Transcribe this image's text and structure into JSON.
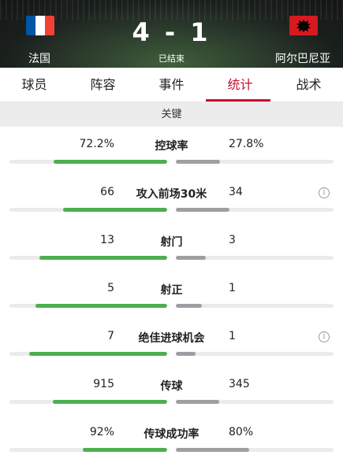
{
  "header": {
    "home_team": "法国",
    "away_team": "阿尔巴尼亚",
    "score": "4 - 1",
    "status": "已结束",
    "home_flag": {
      "colors": [
        "#0055a4",
        "#ffffff",
        "#ef4135"
      ],
      "icon": "france-flag-icon"
    },
    "away_flag": {
      "colors": [
        "#d71a1f",
        "#000000"
      ],
      "icon": "albania-flag-icon"
    }
  },
  "tabs": [
    {
      "label": "球员",
      "active": false
    },
    {
      "label": "阵容",
      "active": false
    },
    {
      "label": "事件",
      "active": false
    },
    {
      "label": "统计",
      "active": true
    },
    {
      "label": "战术",
      "active": false
    }
  ],
  "section_title": "关键",
  "stats": [
    {
      "label": "控球率",
      "home": "72.2%",
      "away": "27.8%",
      "home_bar": 0.722,
      "away_bar": 0.278,
      "info": false
    },
    {
      "label": "攻入前场30米",
      "home": "66",
      "away": "34",
      "home_bar": 0.66,
      "away_bar": 0.34,
      "info": true
    },
    {
      "label": "射门",
      "home": "13",
      "away": "3",
      "home_bar": 0.8125,
      "away_bar": 0.1875,
      "info": false
    },
    {
      "label": "射正",
      "home": "5",
      "away": "1",
      "home_bar": 0.833,
      "away_bar": 0.167,
      "info": false
    },
    {
      "label": "绝佳进球机会",
      "home": "7",
      "away": "1",
      "home_bar": 0.875,
      "away_bar": 0.125,
      "info": true
    },
    {
      "label": "传球",
      "home": "915",
      "away": "345",
      "home_bar": 0.726,
      "away_bar": 0.274,
      "info": false
    },
    {
      "label": "传球成功率",
      "home": "92%",
      "away": "80%",
      "home_bar": 0.535,
      "away_bar": 0.465,
      "info": false
    }
  ],
  "colors": {
    "accent": "#c8102e",
    "home_bar": "#4caf50",
    "away_bar": "#9e9ea3"
  }
}
